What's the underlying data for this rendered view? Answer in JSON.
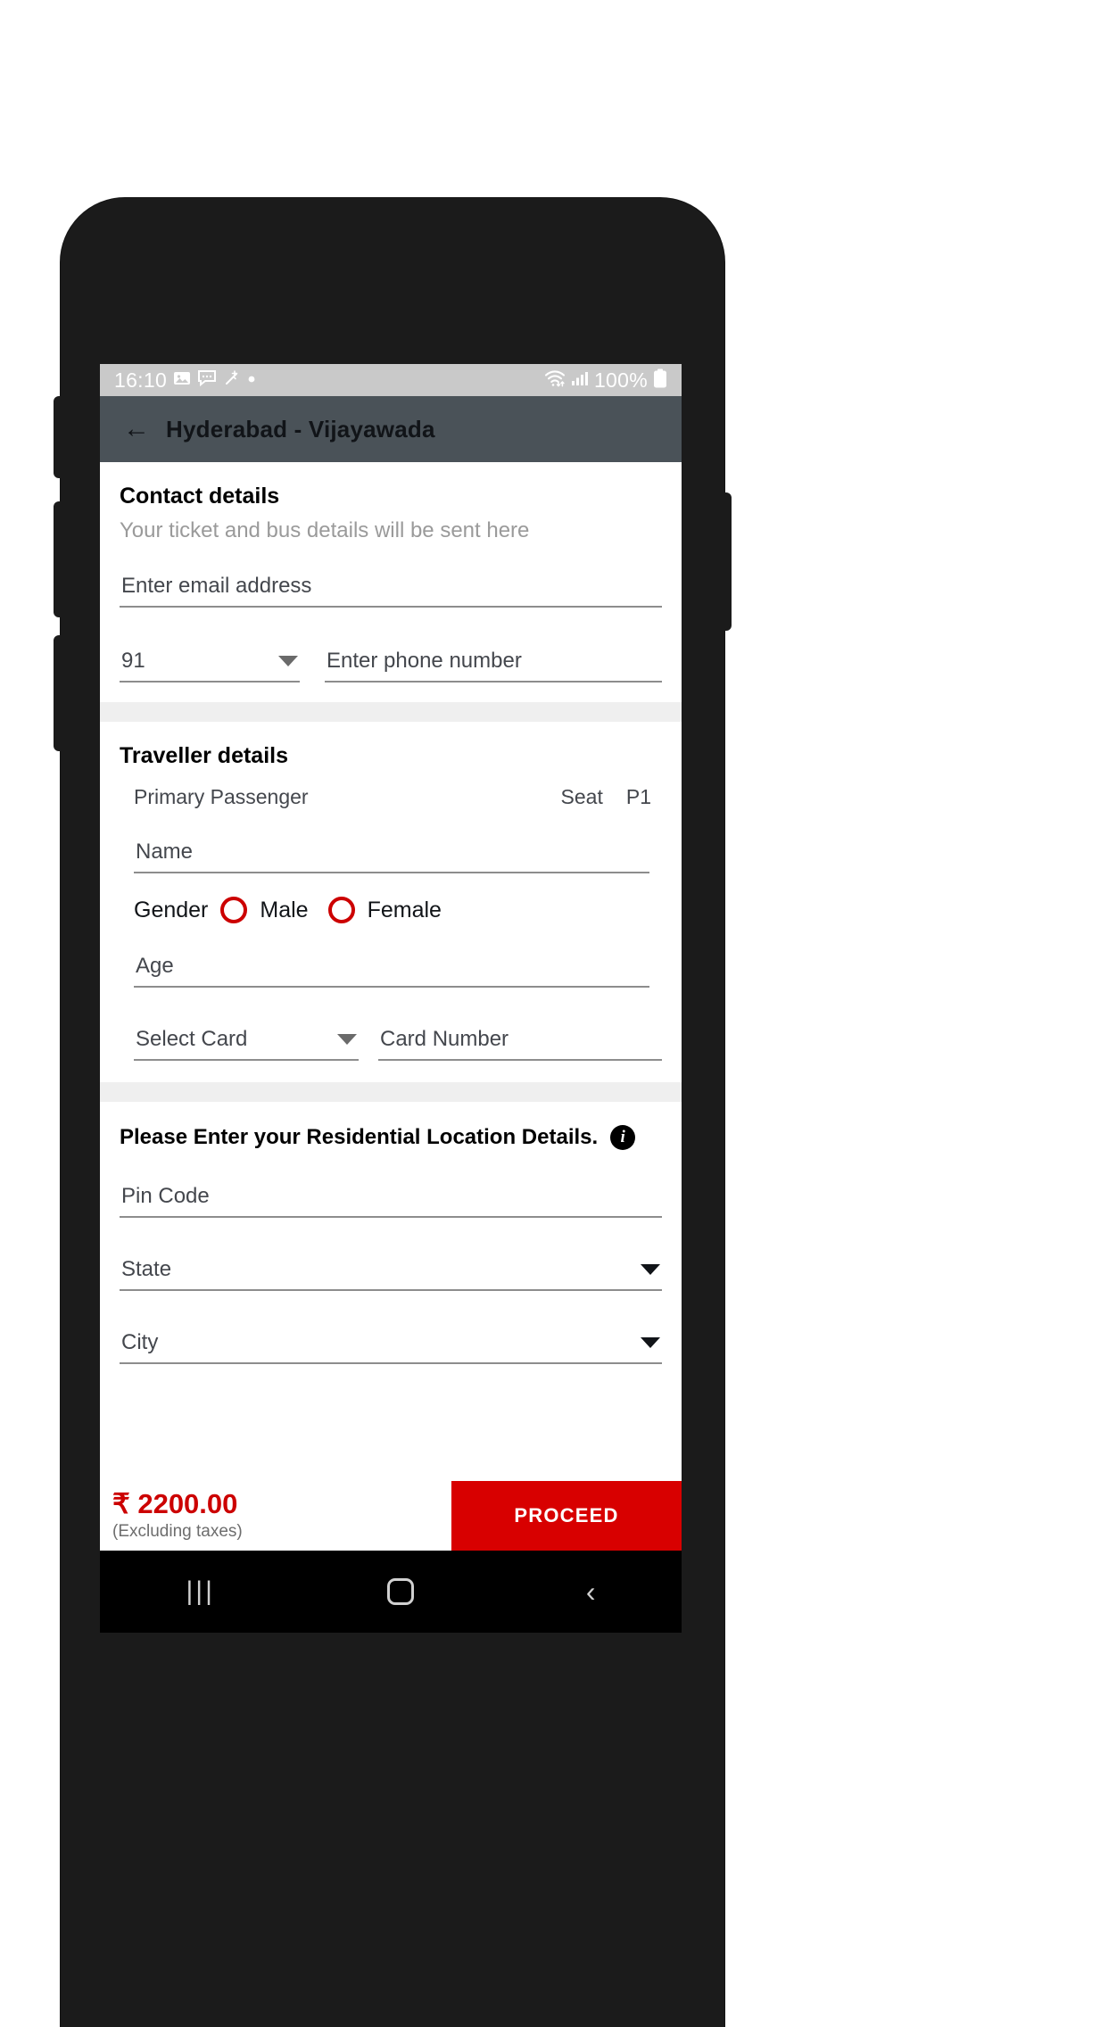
{
  "status_bar": {
    "time": "16:10",
    "battery_percent": "100%",
    "icons": [
      "photo-icon",
      "message-icon",
      "magic-wand-icon",
      "dot-icon",
      "wifi-icon",
      "signal-icon",
      "battery-icon"
    ]
  },
  "header": {
    "back_label": "←",
    "title": "Hyderabad - Vijayawada"
  },
  "contact": {
    "title": "Contact details",
    "subtitle": "Your ticket and bus details will be sent here",
    "email_placeholder": "Enter email address",
    "country_code": "91",
    "phone_placeholder": "Enter phone number"
  },
  "traveller": {
    "title": "Traveller details",
    "passenger_label": "Primary Passenger",
    "seat_label": "Seat",
    "seat_value": "P1",
    "name_placeholder": "Name",
    "gender_label": "Gender",
    "gender_options": [
      "Male",
      "Female"
    ],
    "age_placeholder": "Age",
    "card_select_placeholder": "Select Card",
    "card_number_placeholder": "Card Number"
  },
  "residential": {
    "title": "Please Enter your Residential Location Details.",
    "info_icon": "i",
    "pin_placeholder": "Pin Code",
    "state_placeholder": "State",
    "city_placeholder": "City"
  },
  "bottom_bar": {
    "price": "₹ 2200.00",
    "price_note": "(Excluding taxes)",
    "proceed_label": "PROCEED"
  },
  "nav_bar": {
    "recents": "|||",
    "home": "home-icon",
    "back": "‹"
  },
  "colors": {
    "accent_red": "#cc0000",
    "button_red": "#d80000",
    "header_slate": "#4a5258",
    "status_gray": "#c9c9c9"
  }
}
